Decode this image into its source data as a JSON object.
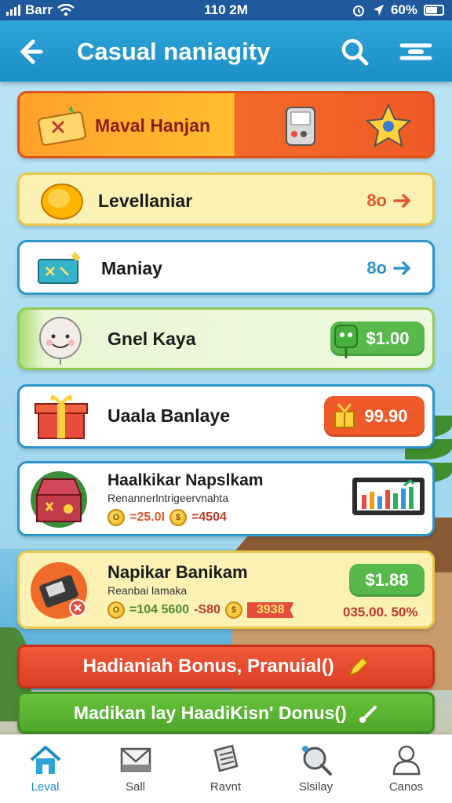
{
  "status_bar": {
    "carrier": "Barr",
    "time": "110 2M",
    "battery": "60%"
  },
  "header": {
    "title": "Casual naniagity"
  },
  "cards": [
    {
      "title": "Maval Hanjan"
    },
    {
      "title": "Levellaniar",
      "value": "8o"
    },
    {
      "title": "Maniay",
      "value": "8o"
    },
    {
      "title": "Gnel Kaya",
      "price": "$1.00"
    },
    {
      "title": "Uaala Banlaye",
      "price": "99.90"
    },
    {
      "title": "Haalkikar Napslkam",
      "subtitle": "Renannerlntrigeervnahta",
      "coin1": "=25.0I",
      "coin2": "=4504"
    },
    {
      "title": "Napikar Banikam",
      "subtitle": "Reanbai lamaka",
      "coin1": "=104 5600",
      "coin2": "-S80",
      "coin3": "3938",
      "price": "$1.88",
      "amount": "035.00. 50%"
    }
  ],
  "bonus": {
    "primary": "Hadianiah Bonus, Pranuial()",
    "secondary": "Madikan lay HaadiKisn' Donus()"
  },
  "bottom_nav": [
    {
      "label": "Leval",
      "active": true
    },
    {
      "label": "Sall"
    },
    {
      "label": "Ravnt"
    },
    {
      "label": "Slsilay"
    },
    {
      "label": "Canos"
    }
  ],
  "colors": {
    "header": "#1b8ec6",
    "accent_orange": "#f05a2a",
    "accent_green": "#4ea72a",
    "accent_blue": "#2e95c9"
  }
}
